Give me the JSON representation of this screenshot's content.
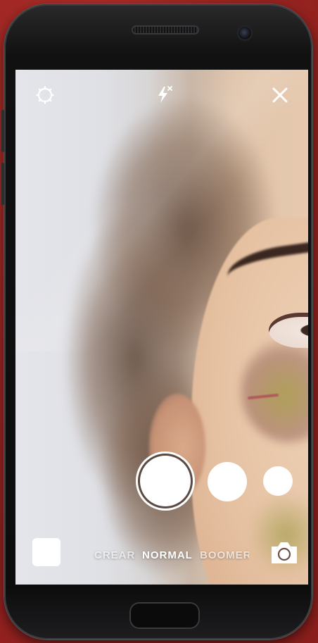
{
  "camera": {
    "modes": [
      "CREAR",
      "NORMAL",
      "BOOMERANG"
    ],
    "active_mode": "NORMAL"
  },
  "icons": {
    "settings": "settings-icon",
    "flash": "flash-off-icon",
    "close": "close-icon",
    "gallery": "gallery-thumbnail",
    "switch_camera": "switch-camera-icon"
  },
  "colors": {
    "background": "#9c2522",
    "ui": "#ffffff"
  }
}
